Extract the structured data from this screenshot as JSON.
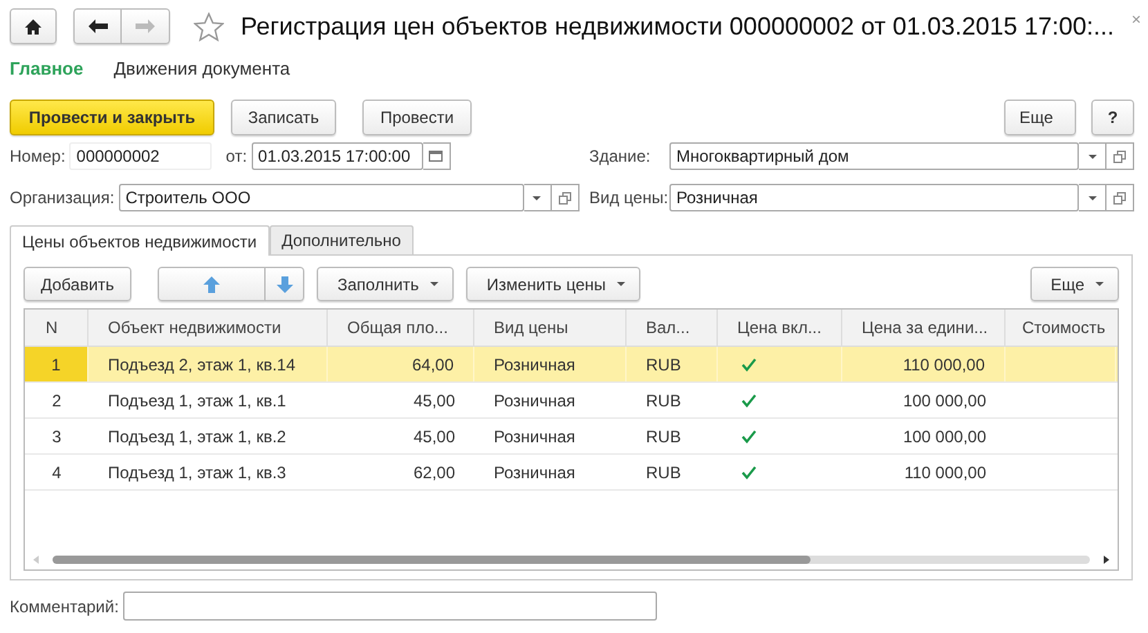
{
  "window": {
    "title": "Регистрация цен объектов недвижимости 000000002 от 01.03.2015 17:00:...",
    "close": "×"
  },
  "nav": [
    {
      "label": "Главное",
      "selected": true
    },
    {
      "label": "Движения документа",
      "selected": false
    }
  ],
  "command_bar": {
    "buttons": [
      {
        "label": "Провести и закрыть",
        "kind": "default"
      },
      {
        "label": "Записать",
        "kind": "plain"
      },
      {
        "label": "Провести",
        "kind": "plain"
      }
    ],
    "more": "Еще",
    "help": "?"
  },
  "fields": {
    "number": {
      "label": "Номер:",
      "value": "000000002"
    },
    "date": {
      "label": "от:",
      "value": "01.03.2015 17:00:00"
    },
    "building": {
      "label": "Здание:",
      "value": "Многоквартирный дом"
    },
    "organization": {
      "label": "Организация:",
      "value": "Строитель ООО"
    },
    "price_type": {
      "label": "Вид цены:",
      "value": "Розничная"
    }
  },
  "tabs": [
    {
      "label": "Цены объектов недвижимости",
      "selected": true
    },
    {
      "label": "Дополнительно",
      "selected": false
    }
  ],
  "table_toolbar": {
    "add": "Добавить",
    "fill": "Заполнить",
    "change_prices": "Изменить цены",
    "more": "Еще"
  },
  "table": {
    "columns": [
      "N",
      "Объект недвижимости",
      "Общая пло...",
      "Вид цены",
      "Вал...",
      "Цена вкл...",
      "Цена за едини...",
      "Стоимость"
    ],
    "rows": [
      {
        "cells": [
          "1",
          "Подъезд 2, этаж 1, кв.14",
          "64,00",
          "Розничная",
          "RUB",
          "110 000,00",
          ""
        ],
        "checked": true,
        "selected": true
      },
      {
        "cells": [
          "2",
          "Подъезд 1, этаж 1, кв.1",
          "45,00",
          "Розничная",
          "RUB",
          "100 000,00",
          ""
        ],
        "checked": true,
        "selected": false
      },
      {
        "cells": [
          "3",
          "Подъезд 1, этаж 1, кв.2",
          "45,00",
          "Розничная",
          "RUB",
          "100 000,00",
          ""
        ],
        "checked": true,
        "selected": false
      },
      {
        "cells": [
          "4",
          "Подъезд 1, этаж 1, кв.3",
          "62,00",
          "Розничная",
          "RUB",
          "110 000,00",
          ""
        ],
        "checked": true,
        "selected": false
      }
    ]
  },
  "comment": {
    "label": "Комментарий:"
  }
}
